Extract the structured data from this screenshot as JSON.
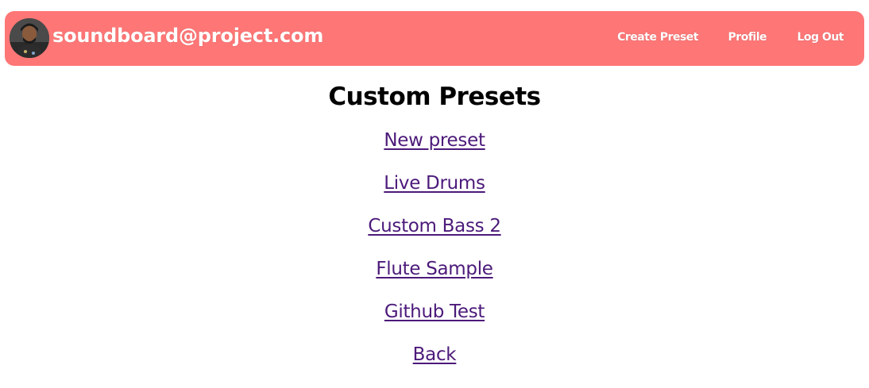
{
  "navbar": {
    "user_email": "soundboard@project.com",
    "links": [
      {
        "label": "Create Preset"
      },
      {
        "label": "Profile"
      },
      {
        "label": "Log Out"
      }
    ],
    "bg_color": "#ff7676"
  },
  "main": {
    "title": "Custom Presets",
    "links": [
      {
        "label": "New preset"
      },
      {
        "label": "Live Drums"
      },
      {
        "label": "Custom Bass 2"
      },
      {
        "label": "Flute Sample"
      },
      {
        "label": "Github Test"
      },
      {
        "label": "Back"
      }
    ],
    "link_color": "#4c1a7a"
  }
}
